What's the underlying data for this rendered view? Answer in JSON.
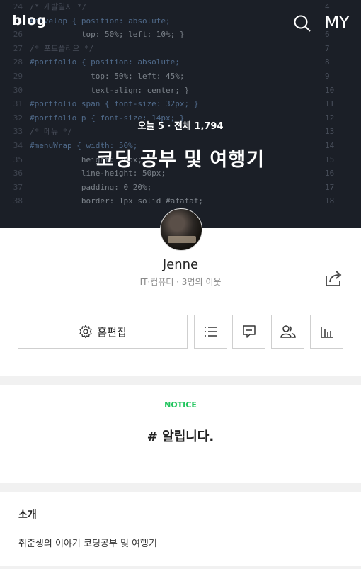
{
  "brand": "blog",
  "my_label": "MY",
  "stats": "오늘 5 · 전체 1,794",
  "blog_title": "코딩 공부 및 여행기",
  "profile": {
    "name": "Jenne",
    "meta": "IT·컴퓨터 · 3명의 이웃"
  },
  "buttons": {
    "home_edit": "홈편집"
  },
  "notice": {
    "label": "NOTICE",
    "title": "# 알립니다."
  },
  "intro": {
    "heading": "소개",
    "text": "취준생의 이야기 코딩공부 및 여행기"
  },
  "code_lines": [
    {
      "ln": "24",
      "text": "/* 개발일지 */"
    },
    {
      "ln": "25",
      "text": "#develop { position: absolute;"
    },
    {
      "ln": "26",
      "text": "           top: 50%; left: 10%; }"
    },
    {
      "ln": "27",
      "text": "/* 포트폴리오 */"
    },
    {
      "ln": "28",
      "text": "#portfolio { position: absolute;"
    },
    {
      "ln": "29",
      "text": "             top: 50%; left: 45%;"
    },
    {
      "ln": "30",
      "text": "             text-align: center; }"
    },
    {
      "ln": "31",
      "text": "#portfolio span { font-size: 32px; }"
    },
    {
      "ln": "32",
      "text": "#portfolio p { font-size: 14px; }"
    },
    {
      "ln": "33",
      "text": "/* 메뉴 */"
    },
    {
      "ln": "34",
      "text": "#menuWrap { width: 50%;"
    },
    {
      "ln": "35",
      "text": "           height: 50px;"
    },
    {
      "ln": "36",
      "text": "           line-height: 50px;"
    },
    {
      "ln": "37",
      "text": "           padding: 0 20%;"
    },
    {
      "ln": "38",
      "text": "           border: 1px solid #afafaf;"
    }
  ],
  "code2_lines": [
    "4",
    "5",
    "6",
    "7",
    "8",
    "9",
    "10",
    "11",
    "12",
    "13",
    "14",
    "15",
    "16",
    "17",
    "18"
  ]
}
